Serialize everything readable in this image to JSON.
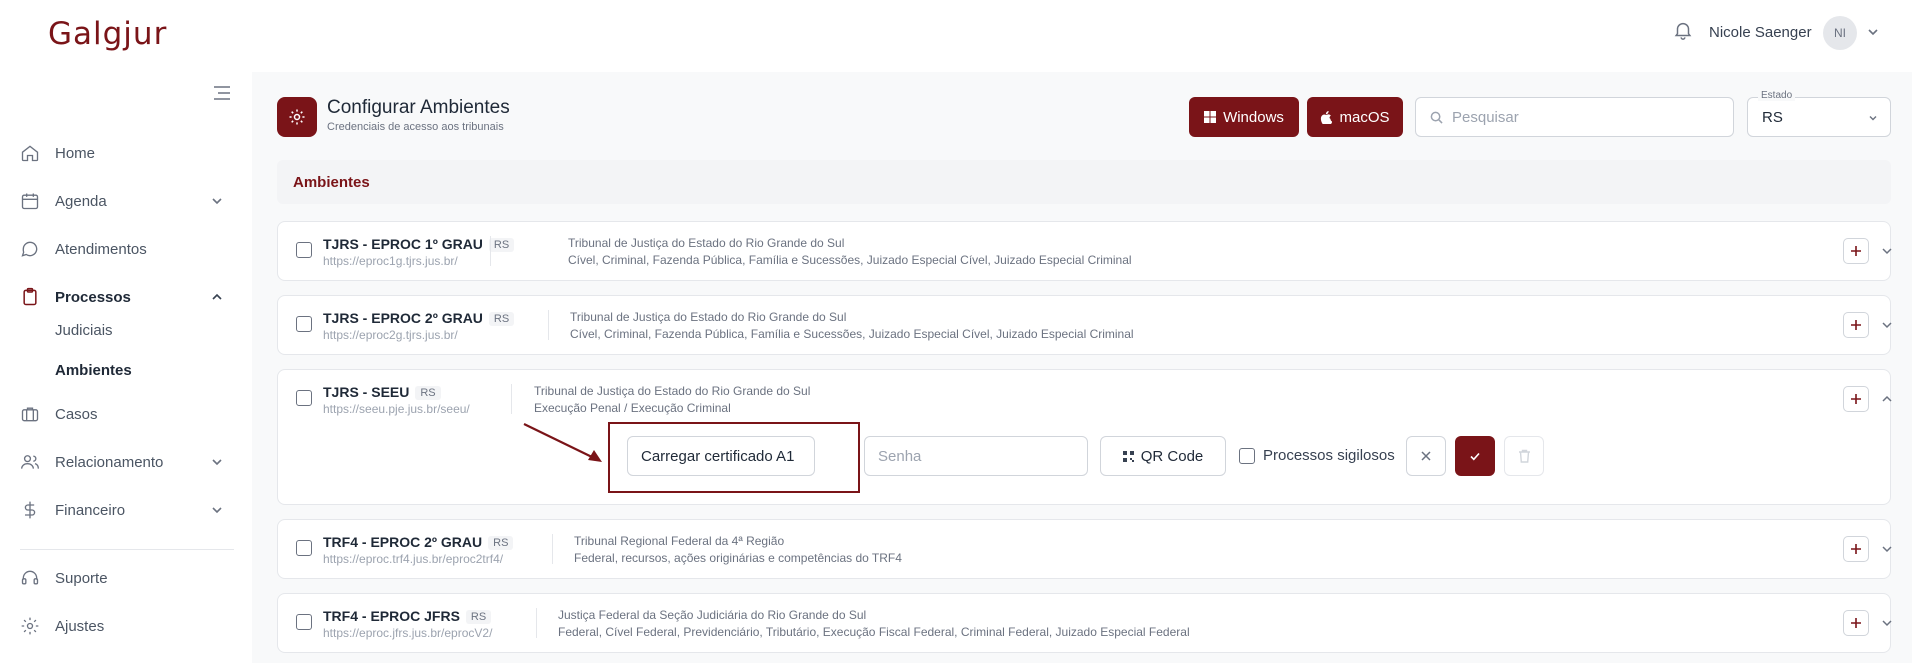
{
  "header": {
    "logo": "Galgjur",
    "user_name": "Nicole Saenger",
    "avatar_initials": "NI"
  },
  "sidebar": {
    "items": [
      {
        "label": "Home",
        "icon": "home-icon"
      },
      {
        "label": "Agenda",
        "icon": "calendar-icon"
      },
      {
        "label": "Atendimentos",
        "icon": "chat-icon"
      },
      {
        "label": "Processos",
        "icon": "clipboard-icon"
      },
      {
        "label": "Casos",
        "icon": "briefcase-icon"
      },
      {
        "label": "Relacionamento",
        "icon": "users-icon"
      },
      {
        "label": "Financeiro",
        "icon": "dollar-icon"
      },
      {
        "label": "Suporte",
        "icon": "headset-icon"
      },
      {
        "label": "Ajustes",
        "icon": "gear-icon"
      }
    ],
    "sub_items": [
      {
        "label": "Judiciais"
      },
      {
        "label": "Ambientes"
      }
    ]
  },
  "main": {
    "title": "Configurar Ambientes",
    "subtitle": "Credenciais de acesso aos tribunais",
    "btn_windows": "Windows",
    "btn_macos": "macOS",
    "search_placeholder": "Pesquisar",
    "estado_label": "Estado",
    "estado_value": "RS",
    "section_title": "Ambientes"
  },
  "environments": [
    {
      "name": "TJRS - EPROC 1º GRAU",
      "state": "RS",
      "url": "https://eproc1g.tjrs.jus.br/",
      "court": "Tribunal de Justiça do Estado do Rio Grande do Sul",
      "areas": "Cível, Criminal, Fazenda Pública, Família e Sucessões, Juizado Especial Cível, Juizado Especial Criminal"
    },
    {
      "name": "TJRS - EPROC 2º GRAU",
      "state": "RS",
      "url": "https://eproc2g.tjrs.jus.br/",
      "court": "Tribunal de Justiça do Estado do Rio Grande do Sul",
      "areas": "Cível, Criminal, Fazenda Pública, Família e Sucessões, Juizado Especial Cível, Juizado Especial Criminal"
    },
    {
      "name": "TJRS - SEEU",
      "state": "RS",
      "url": "https://seeu.pje.jus.br/seeu/",
      "court": "Tribunal de Justiça do Estado do Rio Grande do Sul",
      "areas": "Execução Penal / Execução Criminal"
    },
    {
      "name": "TRF4 - EPROC 2º GRAU",
      "state": "RS",
      "url": "https://eproc.trf4.jus.br/eproc2trf4/",
      "court": "Tribunal Regional Federal da 4ª Região",
      "areas": "Federal, recursos, ações originárias e competências do TRF4"
    },
    {
      "name": "TRF4 - EPROC JFRS",
      "state": "RS",
      "url": "https://eproc.jfrs.jus.br/eprocV2/",
      "court": "Justiça Federal da Seção Judiciária do Rio Grande do Sul",
      "areas": "Federal, Cível Federal, Previdenciário, Tributário, Execução Fiscal Federal, Criminal Federal, Juizado Especial Federal"
    }
  ],
  "expanded_form": {
    "certificate_label": "Carregar certificado A1",
    "password_placeholder": "Senha",
    "qr_label": "QR Code",
    "secret_label": "Processos sigilosos"
  },
  "colors": {
    "brand": "#7a1418",
    "background": "#f8f9fa",
    "border": "#e5e7eb"
  }
}
